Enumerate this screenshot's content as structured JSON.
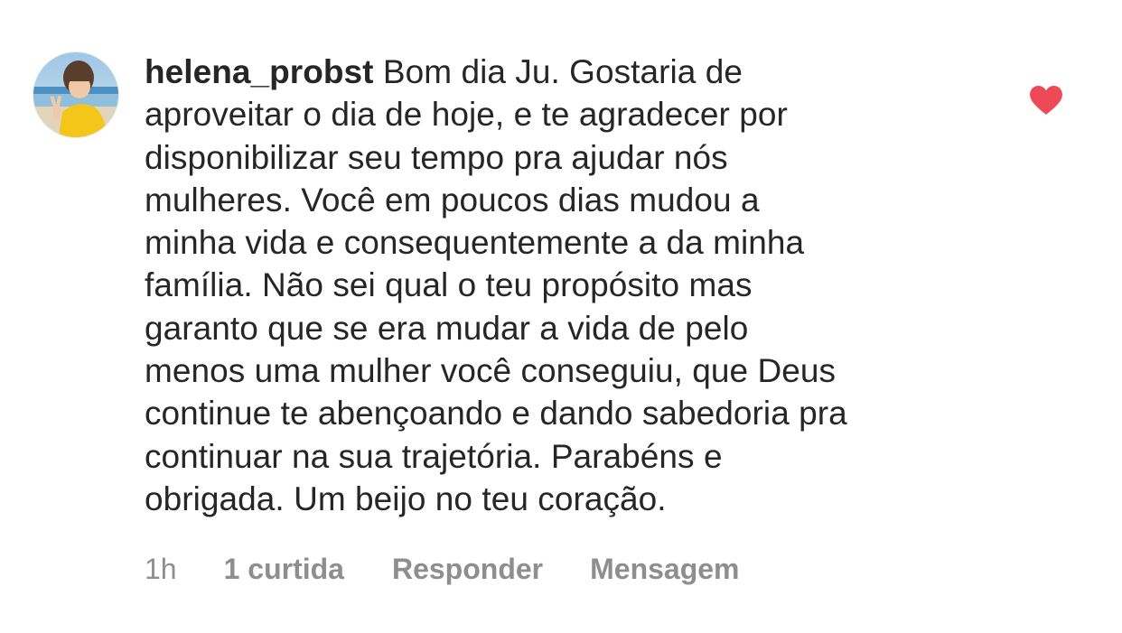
{
  "comment": {
    "username": "helena_probst",
    "text_lines": [
      "Bom dia Ju. Gostaria de",
      "aproveitar o dia de hoje, e te agradecer por",
      "disponibilizar seu tempo pra ajudar nós",
      "mulheres. Você em poucos dias mudou a",
      "minha vida e consequentemente a da minha",
      "família. Não sei qual o teu propósito mas",
      "garanto que se era mudar a vida de pelo",
      "menos uma mulher você conseguiu, que Deus",
      "continue te abençoando e dando sabedoria pra",
      "continuar na sua trajetória. Parabéns e",
      "obrigada. Um beijo no teu coração."
    ],
    "liked": true,
    "heart_color": "#ed4956",
    "avatar_icon": "profile-photo"
  },
  "actions": {
    "time": "1h",
    "likes": "1 curtida",
    "reply": "Responder",
    "message": "Mensagem"
  }
}
